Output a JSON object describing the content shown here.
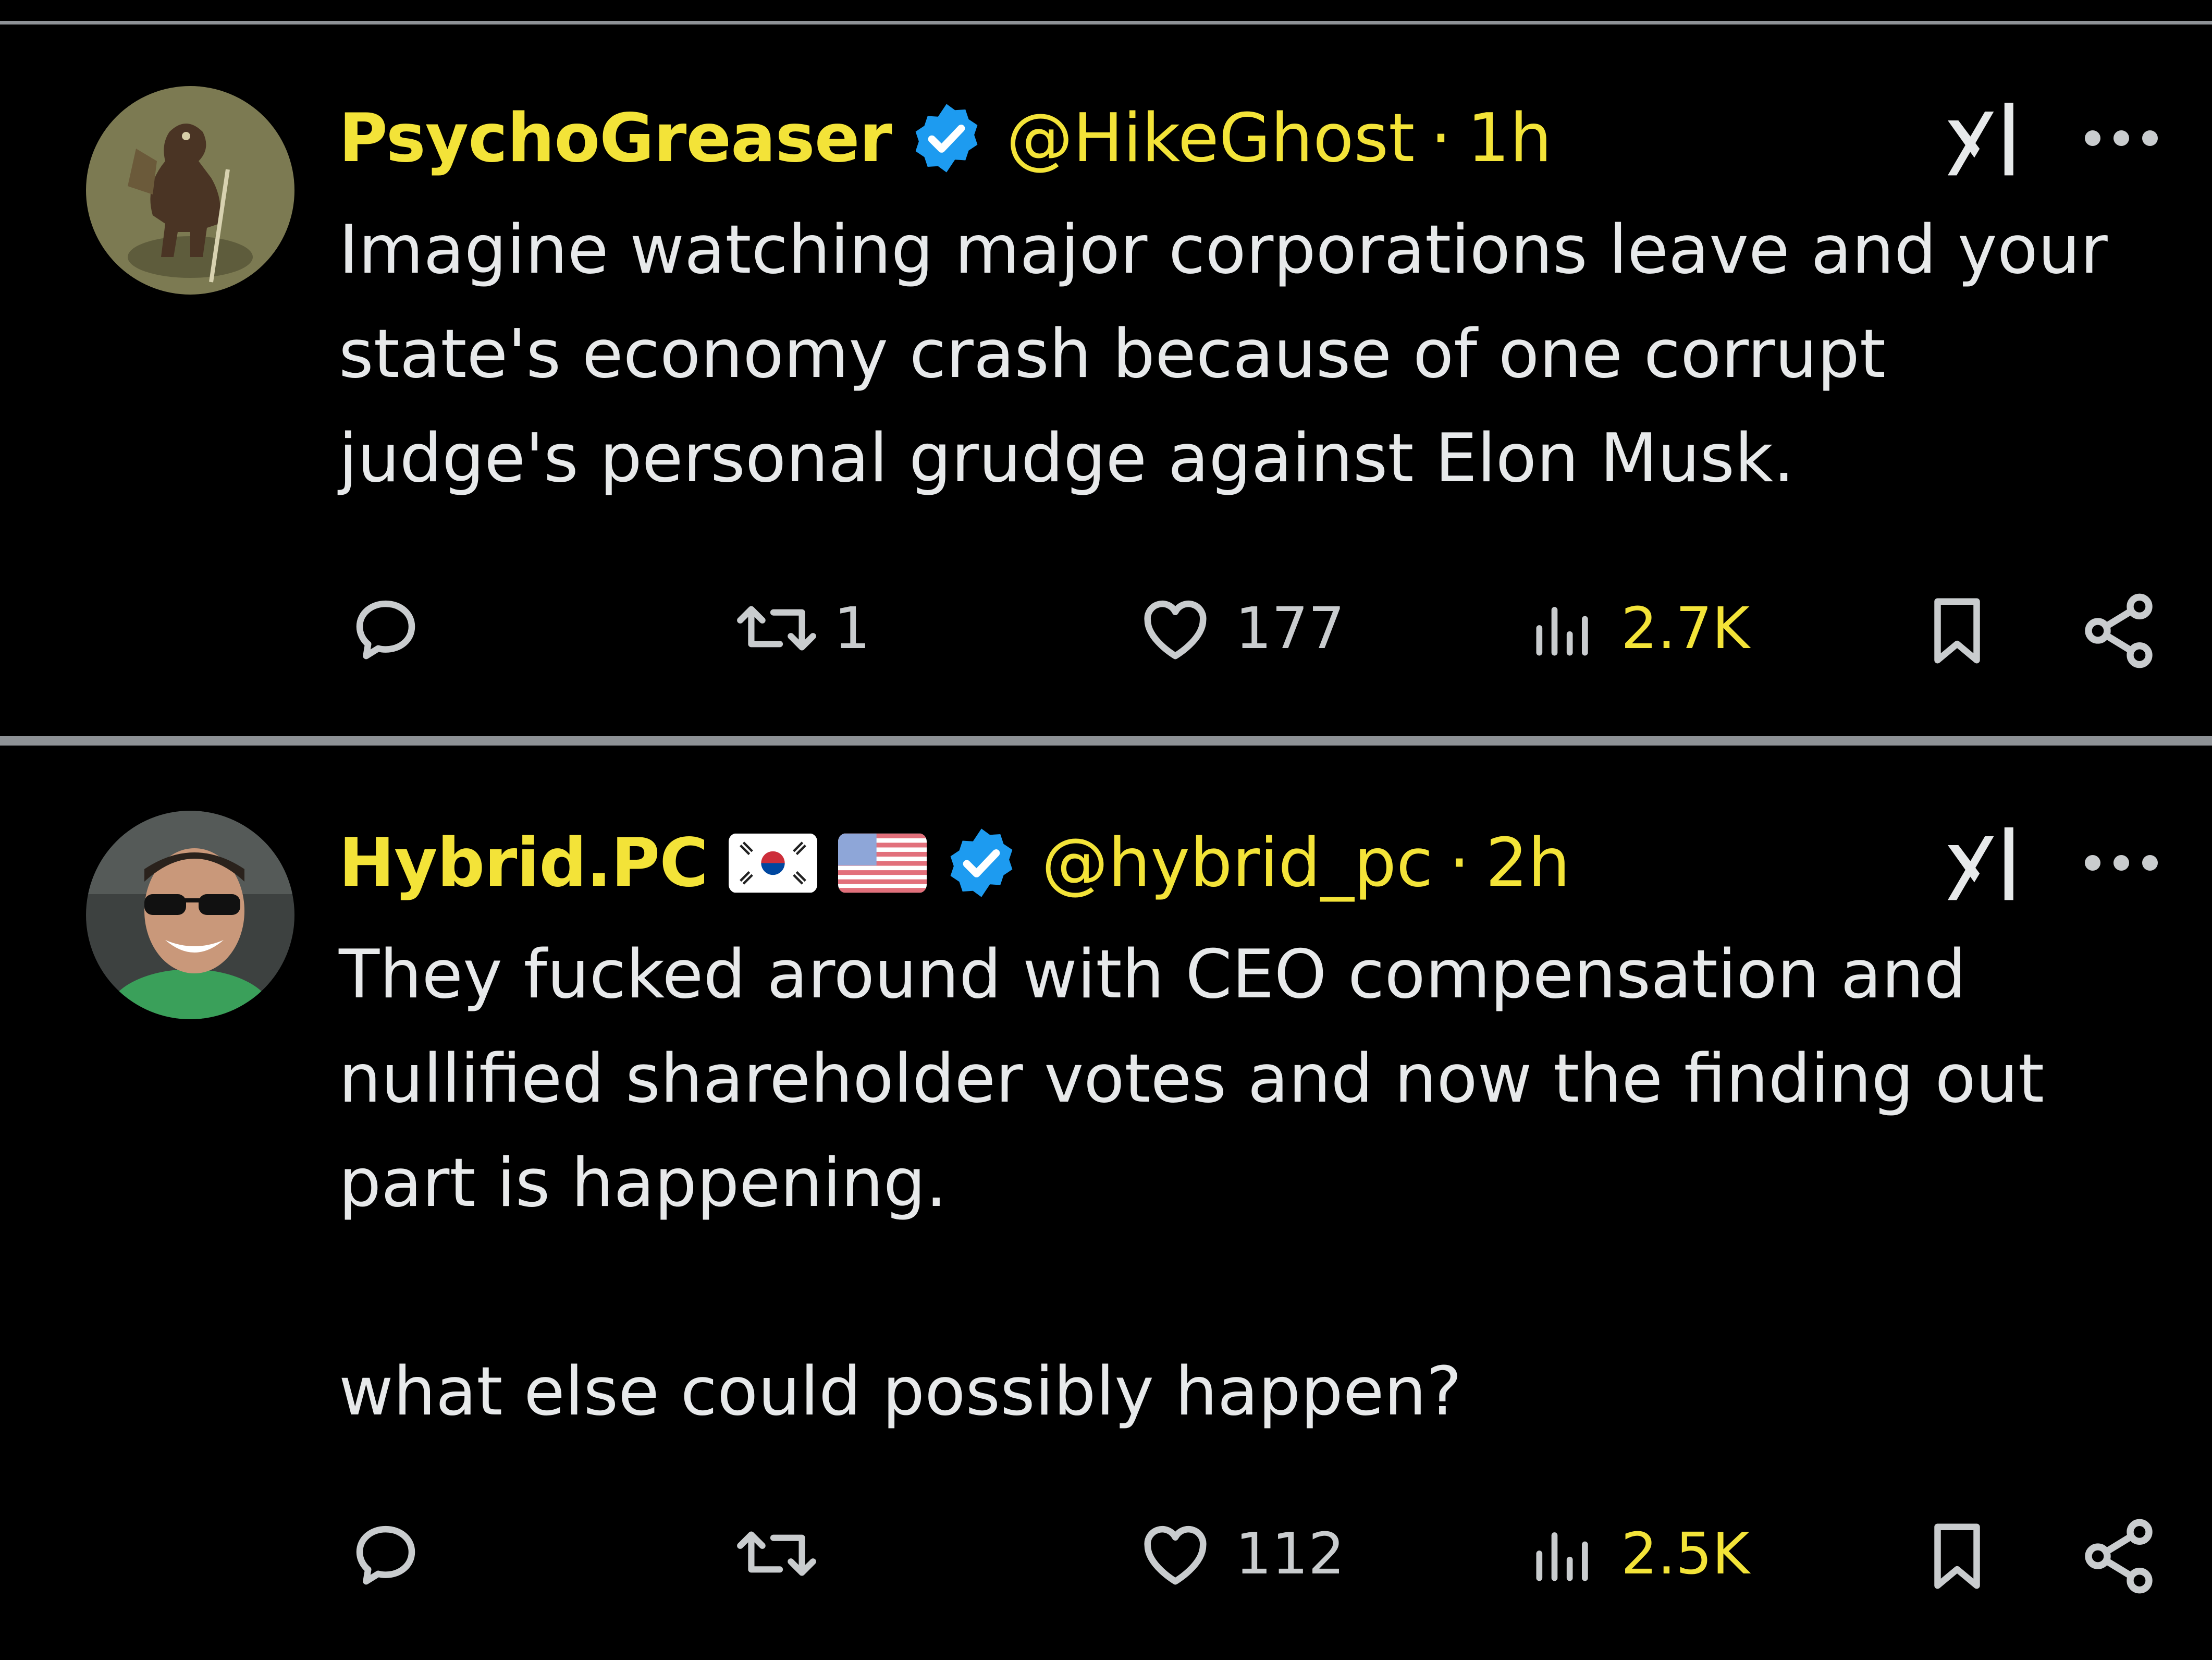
{
  "tweets": [
    {
      "display_name": "PsychoGreaser",
      "verified": true,
      "flags": [],
      "handle": "@HikeGhost",
      "separator": "·",
      "time": "1h",
      "text": "Imagine watching major corporations leave and your\nstate's economy crash because of one corrupt\njudge's personal grudge against Elon Musk.",
      "reply_count": "",
      "retweet_count": "1",
      "like_count": "177",
      "view_count": "2.7K",
      "avatar_icon": "bigfoot-hiker-avatar"
    },
    {
      "display_name": "Hybrid.PC",
      "verified": true,
      "flags": [
        "south-korea-flag",
        "usa-flag"
      ],
      "handle": "@hybrid_pc",
      "separator": "·",
      "time": "2h",
      "text": "They fucked around with CEO compensation and\nnullified shareholder votes and now the finding out\npart is happening.\n\nwhat else could possibly happen?",
      "reply_count": "",
      "retweet_count": "",
      "like_count": "112",
      "view_count": "2.5K",
      "avatar_icon": "man-with-sunglasses-avatar"
    }
  ],
  "colors": {
    "background": "#000000",
    "name_and_handle": "#f3e338",
    "body_text": "#e7e9ea",
    "icon_gray": "#c9ccce",
    "verified_badge": "#1d9bf0",
    "divider": "#8e9296"
  },
  "icons": [
    "reply-icon",
    "retweet-icon",
    "like-icon",
    "views-icon",
    "bookmark-icon",
    "share-icon",
    "grok-icon",
    "more-icon",
    "verified-icon"
  ]
}
